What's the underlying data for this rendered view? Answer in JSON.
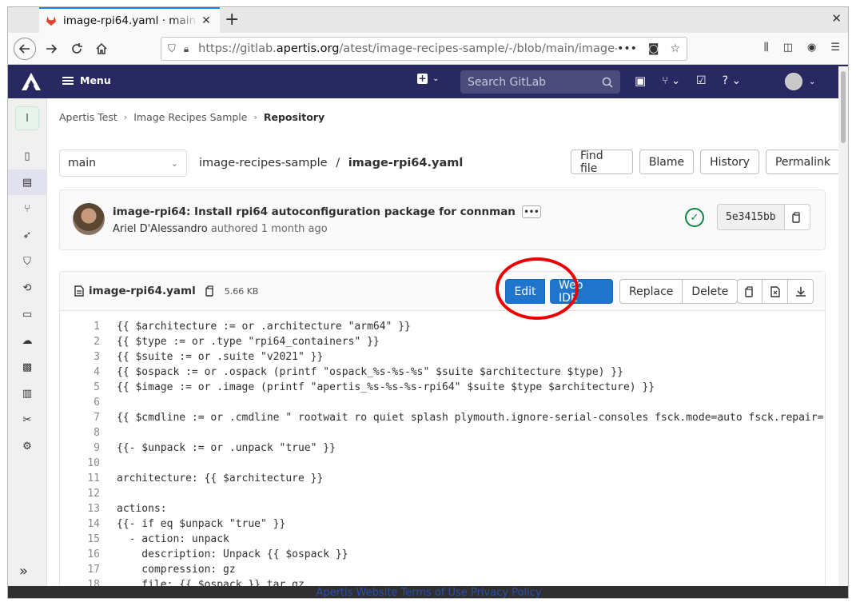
{
  "browser": {
    "tab_title": "image-rpi64.yaml · main",
    "url_prefix": "https://gitlab.",
    "url_domain": "apertis.org",
    "url_rest": "/atest/image-recipes-sample/-/blob/main/image-"
  },
  "header": {
    "menu_label": "Menu",
    "search_placeholder": "Search GitLab"
  },
  "sidebar": {
    "project_letter": "I"
  },
  "breadcrumb": [
    "Apertis Test",
    "Image Recipes Sample",
    "Repository"
  ],
  "branch": "main",
  "path": {
    "dir": "image-recipes-sample",
    "sep": "/",
    "file": "image-rpi64.yaml"
  },
  "top_buttons": [
    "Find file",
    "Blame",
    "History",
    "Permalink"
  ],
  "commit": {
    "title": "image-rpi64: Install rpi64 autoconfiguration package for connman",
    "author": "Ariel D'Alessandro",
    "authored": "authored 1 month ago",
    "sha": "5e3415bb"
  },
  "file": {
    "name": "image-rpi64.yaml",
    "size": "5.66 KB",
    "edit_label": "Edit",
    "webide_label": "Web IDE",
    "replace_label": "Replace",
    "delete_label": "Delete"
  },
  "code_lines": [
    "{{ $architecture := or .architecture \"arm64\" }}",
    "{{ $type := or .type \"rpi64_containers\" }}",
    "{{ $suite := or .suite \"v2021\" }}",
    "{{ $ospack := or .ospack (printf \"ospack_%s-%s-%s\" $suite $architecture $type) }}",
    "{{ $image := or .image (printf \"apertis_%s-%s-%s-rpi64\" $suite $type $architecture) }}",
    "",
    "{{ $cmdline := or .cmdline \" rootwait ro quiet splash plymouth.ignore-serial-consoles fsck.mode=auto fsck.repair=",
    "",
    "{{- $unpack := or .unpack \"true\" }}",
    "",
    "architecture: {{ $architecture }}",
    "",
    "actions:",
    "{{- if eq $unpack \"true\" }}",
    "  - action: unpack",
    "    description: Unpack {{ $ospack }}",
    "    compression: gz",
    "    file: {{ $ospack }}.tar.gz"
  ],
  "footer": "Apertis Website Terms of Use Privacy Policy"
}
